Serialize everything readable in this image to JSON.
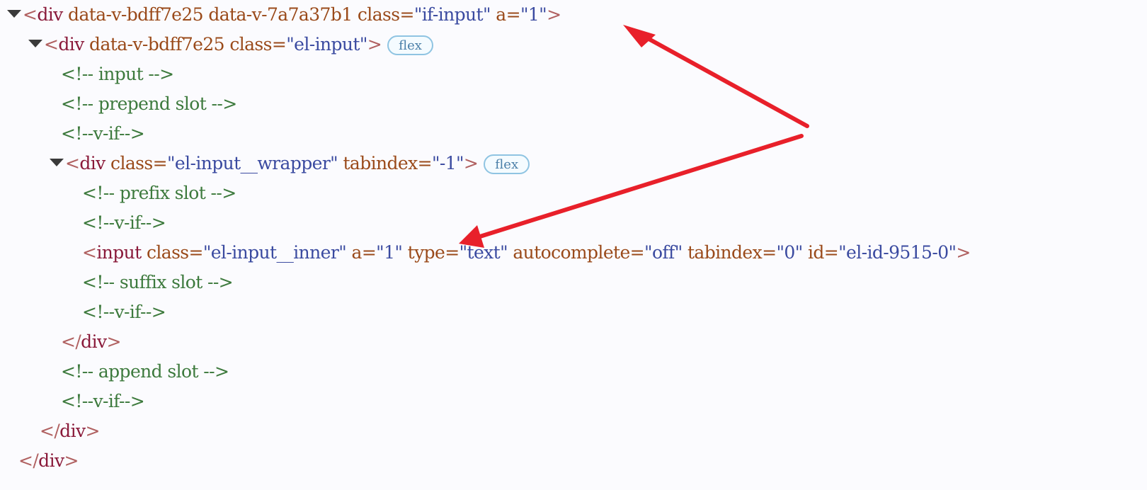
{
  "lines": [
    {
      "indent": 32,
      "triangle": true,
      "kind": "open",
      "tag": "div",
      "attrs": [
        {
          "name": "data-v-bdff7e25"
        },
        {
          "name": "data-v-7a7a37b1"
        },
        {
          "name": "class",
          "value": "if-input"
        },
        {
          "name": "a",
          "value": "1"
        }
      ],
      "badge": null
    },
    {
      "indent": 62,
      "triangle": true,
      "kind": "open",
      "tag": "div",
      "attrs": [
        {
          "name": "data-v-bdff7e25"
        },
        {
          "name": "class",
          "value": "el-input"
        }
      ],
      "badge": "flex"
    },
    {
      "indent": 86,
      "kind": "comment",
      "text": "<!-- input -->"
    },
    {
      "indent": 86,
      "kind": "comment",
      "text": "<!-- prepend slot -->"
    },
    {
      "indent": 86,
      "kind": "comment",
      "text": "<!--v-if-->"
    },
    {
      "indent": 92,
      "triangle": true,
      "kind": "open",
      "tag": "div",
      "attrs": [
        {
          "name": "class",
          "value": "el-input__wrapper"
        },
        {
          "name": "tabindex",
          "value": "-1"
        }
      ],
      "badge": "flex"
    },
    {
      "indent": 116,
      "kind": "comment",
      "text": "<!-- prefix slot -->"
    },
    {
      "indent": 116,
      "kind": "comment",
      "text": "<!--v-if-->"
    },
    {
      "indent": 116,
      "kind": "open",
      "tag": "input",
      "attrs": [
        {
          "name": "class",
          "value": "el-input__inner"
        },
        {
          "name": "a",
          "value": "1"
        },
        {
          "name": "type",
          "value": "text"
        },
        {
          "name": "autocomplete",
          "value": "off"
        },
        {
          "name": "tabindex",
          "value": "0"
        },
        {
          "name": "id",
          "value": "el-id-9515-0"
        }
      ],
      "badge": null
    },
    {
      "indent": 116,
      "kind": "comment",
      "text": "<!-- suffix slot -->"
    },
    {
      "indent": 116,
      "kind": "comment",
      "text": "<!--v-if-->"
    },
    {
      "indent": 86,
      "kind": "close",
      "tag": "div"
    },
    {
      "indent": 86,
      "kind": "comment",
      "text": "<!-- append slot -->"
    },
    {
      "indent": 86,
      "kind": "comment",
      "text": "<!--v-if-->"
    },
    {
      "indent": 56,
      "kind": "close",
      "tag": "div"
    },
    {
      "indent": 26,
      "kind": "close",
      "tag": "div"
    }
  ],
  "colors": {
    "background": "#fbfbfe",
    "tag": "#8a1a3a",
    "attribute_name": "#9a4a1a",
    "attribute_value": "#3a4aa0",
    "comment": "#3d7a3d",
    "badge_border": "#8fc4e2",
    "annotation_arrow": "#e8202a"
  },
  "annotations": {
    "arrows": [
      {
        "points_to": "a=\"1\" on div.if-input"
      },
      {
        "points_to": "a=\"1\" on input.el-input__inner"
      }
    ]
  }
}
